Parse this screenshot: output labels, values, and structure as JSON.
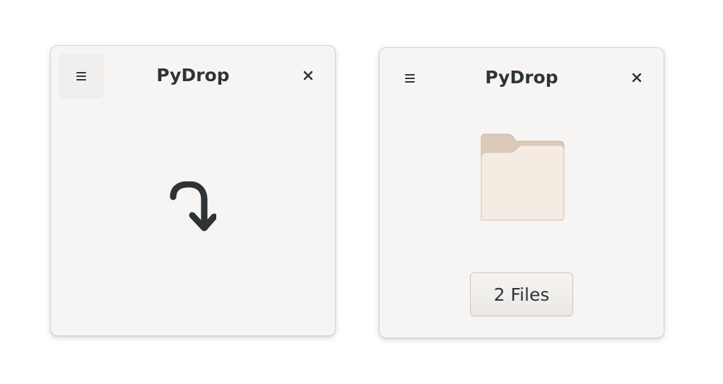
{
  "windows": [
    {
      "title": "PyDrop",
      "menu_icon": "hamburger-menu-icon",
      "close_icon": "close-icon",
      "content_icon": "drop-arrow-icon"
    },
    {
      "title": "PyDrop",
      "menu_icon": "hamburger-menu-icon",
      "close_icon": "close-icon",
      "content_icon": "folder-icon",
      "files_button_label": "2 Files"
    }
  ],
  "colors": {
    "window_bg": "#f6f5f4",
    "text": "#2e3436",
    "folder_tab": "#dccab8",
    "folder_body": "#f4ece3"
  }
}
